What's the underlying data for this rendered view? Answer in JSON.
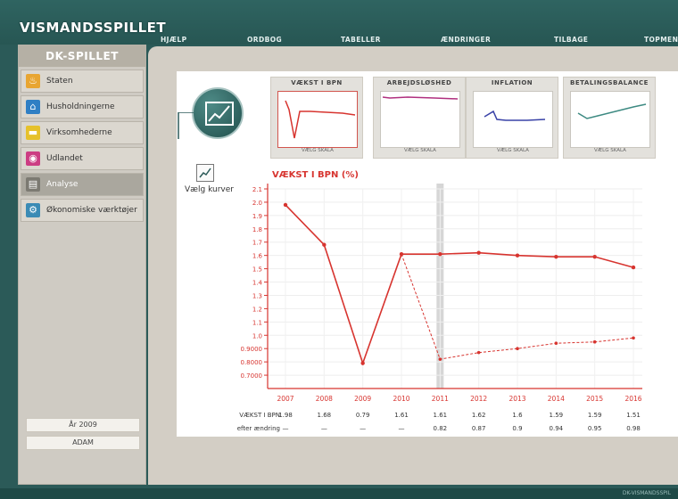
{
  "app": {
    "logo": "VISMANDSSPILLET",
    "copyright": "DK-VISMANDSSPIL"
  },
  "nav": [
    "HJÆLP",
    "ORDBOG",
    "TABELLER",
    "ÆNDRINGER",
    "TILBAGE",
    "TOPMENI"
  ],
  "sidebar": {
    "title": "DK-SPILLET",
    "items": [
      {
        "label": "Staten",
        "icon": "flame-icon",
        "color": "#e8a531"
      },
      {
        "label": "Husholdningerne",
        "icon": "house-icon",
        "color": "#2f7fc4"
      },
      {
        "label": "Virksomhederne",
        "icon": "factory-icon",
        "color": "#e6c12b"
      },
      {
        "label": "Udlandet",
        "icon": "globe-icon",
        "color": "#cc3d83"
      },
      {
        "label": "Analyse",
        "icon": "graph-icon",
        "color": "#7c7a72"
      },
      {
        "label": "Økonomiske værktøjer",
        "icon": "gear-icon",
        "color": "#3b8bb5"
      }
    ],
    "year": "År 2009",
    "player": "ADAM"
  },
  "thumbs": [
    {
      "title": "VÆKST I BPN",
      "scale": "VÆLG SKALA",
      "color": "#d7342f"
    },
    {
      "title": "ARBEJDSLØSHED",
      "scale": "VÆLG SKALA",
      "color": "#b0307f"
    },
    {
      "title": "INFLATION",
      "scale": "VÆLG SKALA",
      "color": "#3942a7"
    },
    {
      "title": "BETALINGSBALANCE",
      "scale": "VÆLG SKALA",
      "color": "#3d8a82"
    }
  ],
  "curves_label": "Vælg kurver",
  "chart_data": {
    "type": "line",
    "title": "VÆKST I BPN (%)",
    "categories": [
      "2007",
      "2008",
      "2009",
      "2010",
      "2011",
      "2012",
      "2013",
      "2014",
      "2015",
      "2016"
    ],
    "yticks": [
      "2.1",
      "2.0",
      "1.9",
      "1.8",
      "1.7",
      "1.6",
      "1.5",
      "1.4",
      "1.3",
      "1.2",
      "1.1",
      "1.0",
      "0.9000",
      "0.8000",
      "0.7000"
    ],
    "ylim": [
      0.6,
      2.1
    ],
    "series": [
      {
        "name": "VÆKST I BPN",
        "values": [
          1.98,
          1.68,
          0.79,
          1.61,
          1.61,
          1.62,
          1.6,
          1.59,
          1.59,
          1.51
        ],
        "color": "#d7342f",
        "style": "solid"
      },
      {
        "name": "efter ændring",
        "values": [
          null,
          null,
          null,
          1.61,
          0.82,
          0.87,
          0.9,
          0.94,
          0.95,
          0.98
        ],
        "color": "#d7342f",
        "style": "dashed"
      }
    ],
    "table": {
      "rows": [
        {
          "label": "VÆKST I BPN",
          "cells": [
            "1.98",
            "1.68",
            "0.79",
            "1.61",
            "1.61",
            "1.62",
            "1.6",
            "1.59",
            "1.59",
            "1.51"
          ]
        },
        {
          "label": "efter ændring",
          "cells": [
            "—",
            "—",
            "—",
            "—",
            "0.82",
            "0.87",
            "0.9",
            "0.94",
            "0.95",
            "0.98"
          ]
        }
      ]
    }
  }
}
